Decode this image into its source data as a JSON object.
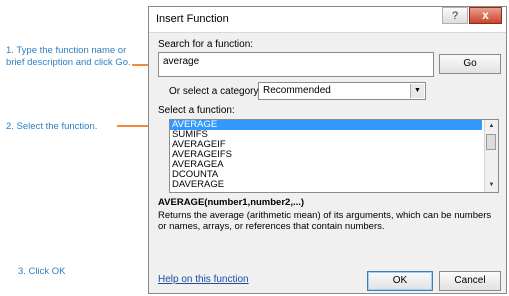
{
  "annotations": {
    "step1": "1. Type the function name or brief description and click Go.",
    "step2": "2. Select the function.",
    "step3": "3. Click OK"
  },
  "dialog": {
    "title": "Insert Function",
    "help_icon": "?",
    "close_icon": "x",
    "search_label": "Search for a function:",
    "search_value": "average",
    "go_label": "Go",
    "category_label": "Or select a category:",
    "category_value": "Recommended",
    "select_label": "Select a function:",
    "functions": [
      "AVERAGE",
      "SUMIFS",
      "AVERAGEIF",
      "AVERAGEIFS",
      "AVERAGEA",
      "DCOUNTA",
      "DAVERAGE"
    ],
    "selected_function": "AVERAGE",
    "signature": "AVERAGE(number1,number2,...)",
    "description": "Returns the average (arithmetic mean) of its arguments, which can be numbers or names, arrays, or references that contain numbers.",
    "help_link": "Help on this function",
    "ok_label": "OK",
    "cancel_label": "Cancel"
  },
  "colors": {
    "annotation": "#2f7fc1",
    "arrow": "#f08a3c",
    "selection": "#3399ff"
  }
}
